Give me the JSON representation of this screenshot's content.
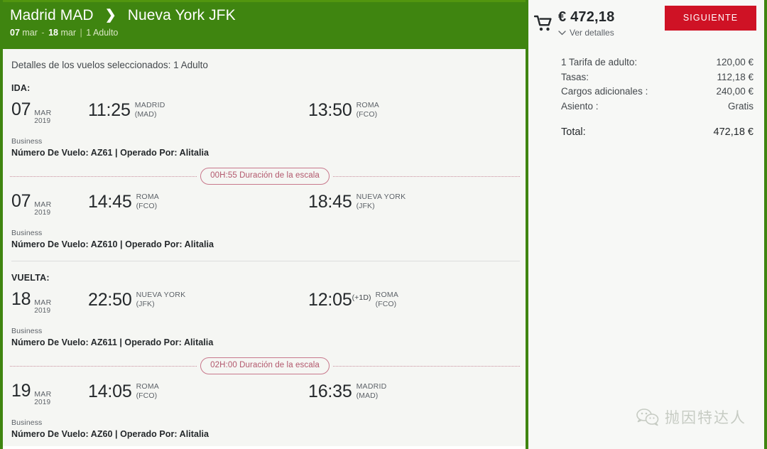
{
  "trip": {
    "origin": "Madrid MAD",
    "arrow_icon": "chevron-right-icon",
    "destination": "Nueva York JFK",
    "depart_day": "07",
    "depart_mon": "mar",
    "return_day": "18",
    "return_mon": "mar",
    "separator": "|",
    "passengers": "1 Adulto"
  },
  "flights": {
    "pane_title": "Detalles de los vuelos seleccionados: 1 Adulto",
    "outbound_label": "IDA:",
    "return_label": "VUELTA:",
    "segments": [
      {
        "date_day": "07",
        "date_month": "MAR",
        "date_year": "2019",
        "dep_time": "11:25",
        "dep_city": "MADRID",
        "dep_code": "(MAD)",
        "arr_time": "13:50",
        "arr_plus": "",
        "arr_city": "ROMA",
        "arr_code": "(FCO)",
        "cabin": "Business",
        "flight_info": "Número De Vuelo: AZ61 | Operado Por: Alitalia",
        "layover_after": "00H:55 Duración de la escala"
      },
      {
        "date_day": "07",
        "date_month": "MAR",
        "date_year": "2019",
        "dep_time": "14:45",
        "dep_city": "ROMA",
        "dep_code": "(FCO)",
        "arr_time": "18:45",
        "arr_plus": "",
        "arr_city": "NUEVA YORK",
        "arr_code": "(JFK)",
        "cabin": "Business",
        "flight_info": "Número De Vuelo: AZ610 | Operado Por: Alitalia",
        "layover_after": ""
      },
      {
        "date_day": "18",
        "date_month": "MAR",
        "date_year": "2019",
        "dep_time": "22:50",
        "dep_city": "NUEVA YORK",
        "dep_code": "(JFK)",
        "arr_time": "12:05",
        "arr_plus": "(+1D)",
        "arr_city": "ROMA",
        "arr_code": "(FCO)",
        "cabin": "Business",
        "flight_info": "Número De Vuelo: AZ611 | Operado Por: Alitalia",
        "layover_after": "02H:00 Duración de la escala"
      },
      {
        "date_day": "19",
        "date_month": "MAR",
        "date_year": "2019",
        "dep_time": "14:05",
        "dep_city": "ROMA",
        "dep_code": "(FCO)",
        "arr_time": "16:35",
        "arr_plus": "",
        "arr_city": "MADRID",
        "arr_code": "(MAD)",
        "cabin": "Business",
        "flight_info": "Número De Vuelo: AZ60 | Operado Por: Alitalia",
        "layover_after": ""
      }
    ]
  },
  "summary": {
    "cart_icon": "shopping-cart-icon",
    "total_price": "€ 472,18",
    "details_toggle": "Ver detalles",
    "details_chevron": "chevron-down-icon",
    "next_button": "SIGUIENTE",
    "rows": [
      {
        "label": "1 Tarifa de adulto:",
        "value": "120,00 €"
      },
      {
        "label": "Tasas:",
        "value": "112,18 €"
      },
      {
        "label": "Cargos adicionales :",
        "value": "240,00 €"
      },
      {
        "label": "Asiento :",
        "value": "Gratis"
      }
    ],
    "total_label": "Total:",
    "total_value": "472,18 €"
  },
  "watermark": {
    "icon": "wechat-icon",
    "text": "抛因特达人"
  },
  "colors": {
    "brand_green": "#3f8510",
    "accent_red": "#cf1225",
    "layover_pink": "#b2576c",
    "pane_bg": "#f5f6f3"
  }
}
